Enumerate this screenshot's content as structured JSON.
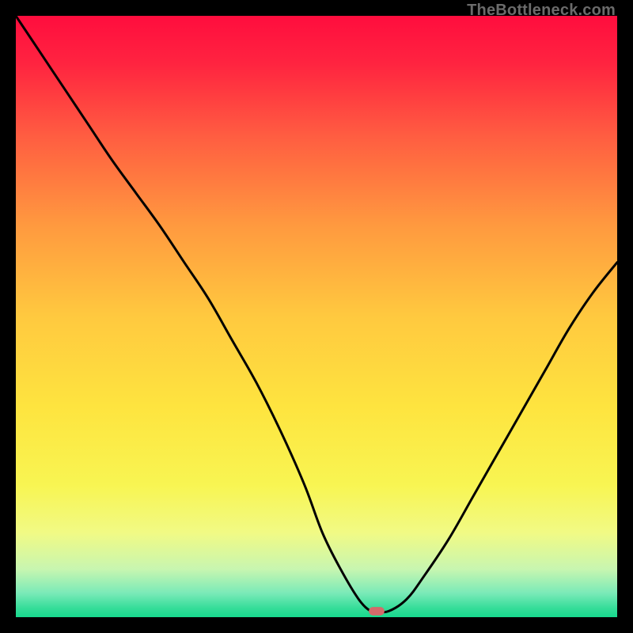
{
  "watermark": "TheBottleneck.com",
  "chart_data": {
    "type": "line",
    "title": "",
    "xlabel": "",
    "ylabel": "",
    "xlim": [
      0,
      100
    ],
    "ylim": [
      0,
      100
    ],
    "grid": false,
    "background_gradient": {
      "type": "vertical",
      "stops": [
        {
          "pos": 0.0,
          "color": "#ff0d3e"
        },
        {
          "pos": 0.08,
          "color": "#ff2440"
        },
        {
          "pos": 0.2,
          "color": "#ff5d41"
        },
        {
          "pos": 0.35,
          "color": "#ff9a3f"
        },
        {
          "pos": 0.5,
          "color": "#ffc93f"
        },
        {
          "pos": 0.65,
          "color": "#fee43f"
        },
        {
          "pos": 0.78,
          "color": "#f8f552"
        },
        {
          "pos": 0.86,
          "color": "#f1fa85"
        },
        {
          "pos": 0.92,
          "color": "#c8f6b0"
        },
        {
          "pos": 0.96,
          "color": "#7aeab8"
        },
        {
          "pos": 0.985,
          "color": "#35dd99"
        },
        {
          "pos": 1.0,
          "color": "#17d98e"
        }
      ]
    },
    "series": [
      {
        "name": "bottleneck-curve",
        "color": "#000000",
        "x": [
          0,
          4,
          8,
          12,
          16,
          20,
          24,
          28,
          32,
          36,
          40,
          44,
          48,
          51,
          54,
          57,
          59,
          60,
          62,
          65,
          68,
          72,
          76,
          80,
          84,
          88,
          92,
          96,
          100
        ],
        "y": [
          100,
          94,
          88,
          82,
          76,
          70.5,
          65,
          59,
          53,
          46,
          39,
          31,
          22,
          14,
          8,
          3,
          1,
          1,
          1,
          3,
          7,
          13,
          20,
          27,
          34,
          41,
          48,
          54,
          59
        ]
      }
    ],
    "marker": {
      "name": "optimal-point",
      "x": 60,
      "y": 1,
      "shape": "pill",
      "color": "#d46a6a",
      "width": 2.6,
      "height": 1.4
    }
  }
}
